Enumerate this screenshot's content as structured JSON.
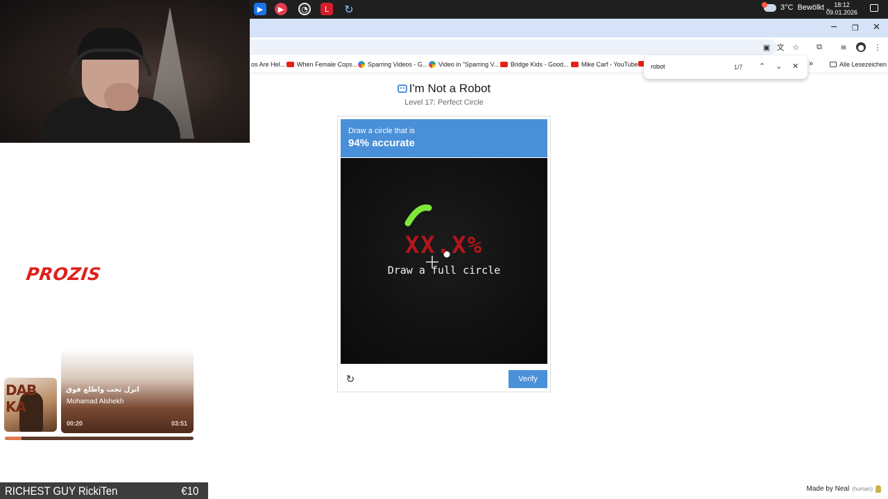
{
  "taskbar": {
    "weather_temp": "3°C",
    "weather_text": "Bewölkt",
    "time": "18:12",
    "date": "09.01.2026"
  },
  "window_controls": {
    "minimize": "─",
    "restore": "❐",
    "close": "✕"
  },
  "bookmarks": [
    {
      "label": "os Are Hel..."
    },
    {
      "label": "When Female Cops..."
    },
    {
      "label": "Sparring Videos - G..."
    },
    {
      "label": "Video in \"Sparring V..."
    },
    {
      "label": "Bridge Kids - Good..."
    },
    {
      "label": "Mike Carf - YouTube"
    }
  ],
  "bookmarks_overflow": "»",
  "all_bookmarks": "Alle Lesezeichen",
  "find": {
    "query": "robot",
    "count": "1/7"
  },
  "sponsor": "PROZIS",
  "music": {
    "cover_text": "DAB KA",
    "title": "انزل تحت واطلع فوق",
    "artist": "Mohamad Alshekh",
    "elapsed": "00:20",
    "duration": "03:51",
    "progress": 0.087
  },
  "richest": {
    "label": "RICHEST GUY RickiTen",
    "amount": "€10"
  },
  "madeby": {
    "label": "Made by Neal",
    "tag": "(human)"
  },
  "captcha": {
    "title": "I'm Not a Robot",
    "subtitle": "Level 17: Perfect Circle",
    "prompt": "Draw a circle that is",
    "target": "94% accurate",
    "score": "XX.X%",
    "instruction": "Draw a full circle",
    "verify": "Verify",
    "stroke_color": "#7dea3a"
  }
}
